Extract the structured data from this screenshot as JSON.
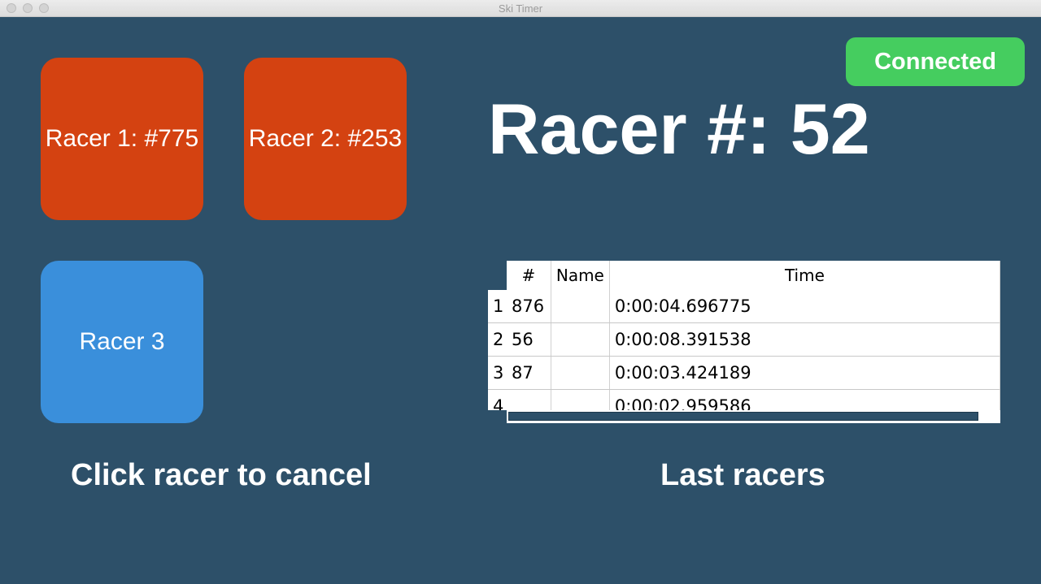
{
  "window": {
    "title": "Ski Timer"
  },
  "racers": {
    "racer1": "Racer 1: #775",
    "racer2": "Racer 2: #253",
    "racer3": "Racer 3"
  },
  "status": {
    "label": "Connected",
    "color": "#45cd5f"
  },
  "current": {
    "label": "Racer #: 52"
  },
  "table": {
    "headers": [
      "#",
      "Name",
      "Time"
    ],
    "rows": [
      {
        "row": "1",
        "num": "876",
        "name": "",
        "time": "0:00:04.696775"
      },
      {
        "row": "2",
        "num": "56",
        "name": "",
        "time": "0:00:08.391538"
      },
      {
        "row": "3",
        "num": "87",
        "name": "",
        "time": "0:00:03.424189"
      },
      {
        "row": "4",
        "num": "",
        "name": "",
        "time": "0:00:02.959586"
      }
    ]
  },
  "captions": {
    "cancel": "Click racer to cancel",
    "last": "Last racers"
  },
  "colors": {
    "background": "#2d5069",
    "active_racer": "#d44211",
    "idle_racer": "#3a8fdb"
  }
}
